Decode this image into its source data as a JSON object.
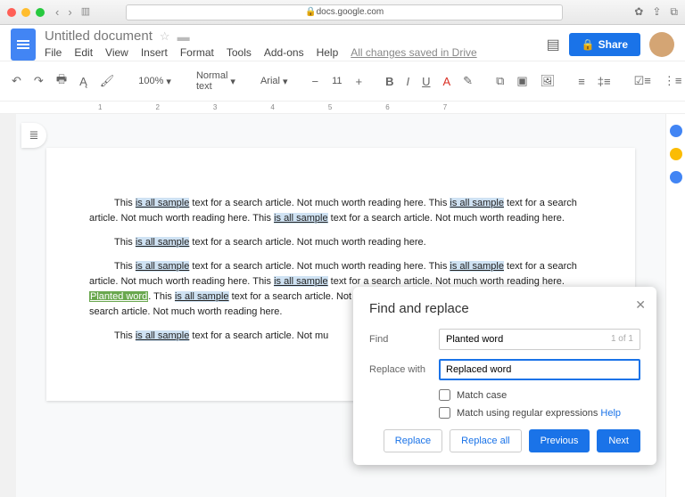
{
  "browser": {
    "url": "docs.google.com"
  },
  "doc": {
    "title": "Untitled document",
    "menus": [
      "File",
      "Edit",
      "View",
      "Insert",
      "Format",
      "Tools",
      "Add-ons",
      "Help"
    ],
    "saved": "All changes saved in Drive",
    "share": "Share"
  },
  "toolbar": {
    "zoom": "100%",
    "style": "Normal text",
    "font": "Arial",
    "size": "11"
  },
  "ruler": [
    "1",
    "2",
    "3",
    "4",
    "5",
    "6",
    "7"
  ],
  "content": {
    "sample": "is all sample",
    "planted": "Planted word",
    "p1a": "This ",
    "p1b": " text for a search article. Not much worth reading here. This ",
    "p1c": " text for a search article. Not much worth reading here. This ",
    "p1d": " text for a search article. Not much worth reading here.",
    "p2a": "This ",
    "p2b": " text for a search article. Not much worth reading here.",
    "p3a": "This ",
    "p3b": " text for a search article. Not much worth reading here. This ",
    "p3c": " text for a search article. Not much worth reading here. This ",
    "p3d": " text for a search article. Not much worth reading here. ",
    "p3e": " This ",
    "p3f": " text for a search article. Not much worth reading here. This ",
    "p3g": " text for a search article. Not much worth reading here.",
    "p4a": "This ",
    "p4b": " text for a search article. Not mu"
  },
  "dialog": {
    "title": "Find and replace",
    "find_label": "Find",
    "find_value": "Planted word",
    "find_count": "1 of 1",
    "replace_label": "Replace with",
    "replace_value": "Replaced word",
    "match_case": "Match case",
    "match_regex": "Match using regular expressions ",
    "help": "Help",
    "btn_replace": "Replace",
    "btn_replace_all": "Replace all",
    "btn_prev": "Previous",
    "btn_next": "Next"
  }
}
